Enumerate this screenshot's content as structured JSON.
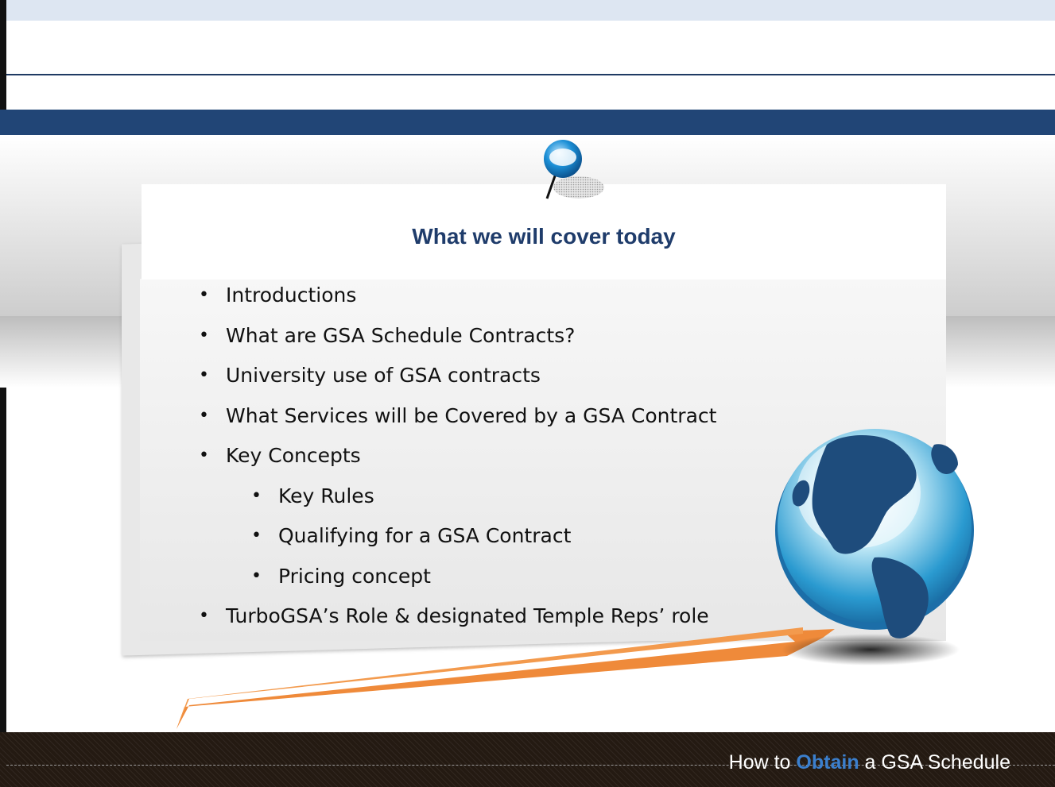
{
  "slide": {
    "title": "What we will cover today",
    "bullets": [
      {
        "text": "Introductions",
        "level": 1
      },
      {
        "text": "What are GSA Schedule Contracts?",
        "level": 1
      },
      {
        "text": "University use of GSA contracts",
        "level": 1
      },
      {
        "text": "What Services will be Covered by a GSA Contract",
        "level": 1
      },
      {
        "text": "Key Concepts",
        "level": 1
      },
      {
        "text": "Key Rules",
        "level": 2
      },
      {
        "text": "Qualifying for a GSA Contract",
        "level": 2
      },
      {
        "text": "Pricing concept",
        "level": 2
      },
      {
        "text": "TurboGSA’s Role & designated Temple Reps’ role",
        "level": 1
      }
    ],
    "bullet_glyph": "•"
  },
  "footer": {
    "prefix": "How to ",
    "highlight": "Obtain",
    "suffix": " a GSA Schedule"
  },
  "icons": {
    "pin": "push-pin-icon",
    "globe": "globe-icon",
    "ribbon": "orange-ribbon"
  },
  "colors": {
    "title": "#1f3c6b",
    "band": "#214576",
    "accent": "#3b7fcd",
    "ribbon": "#ef8a3a",
    "footer": "#241a12"
  }
}
